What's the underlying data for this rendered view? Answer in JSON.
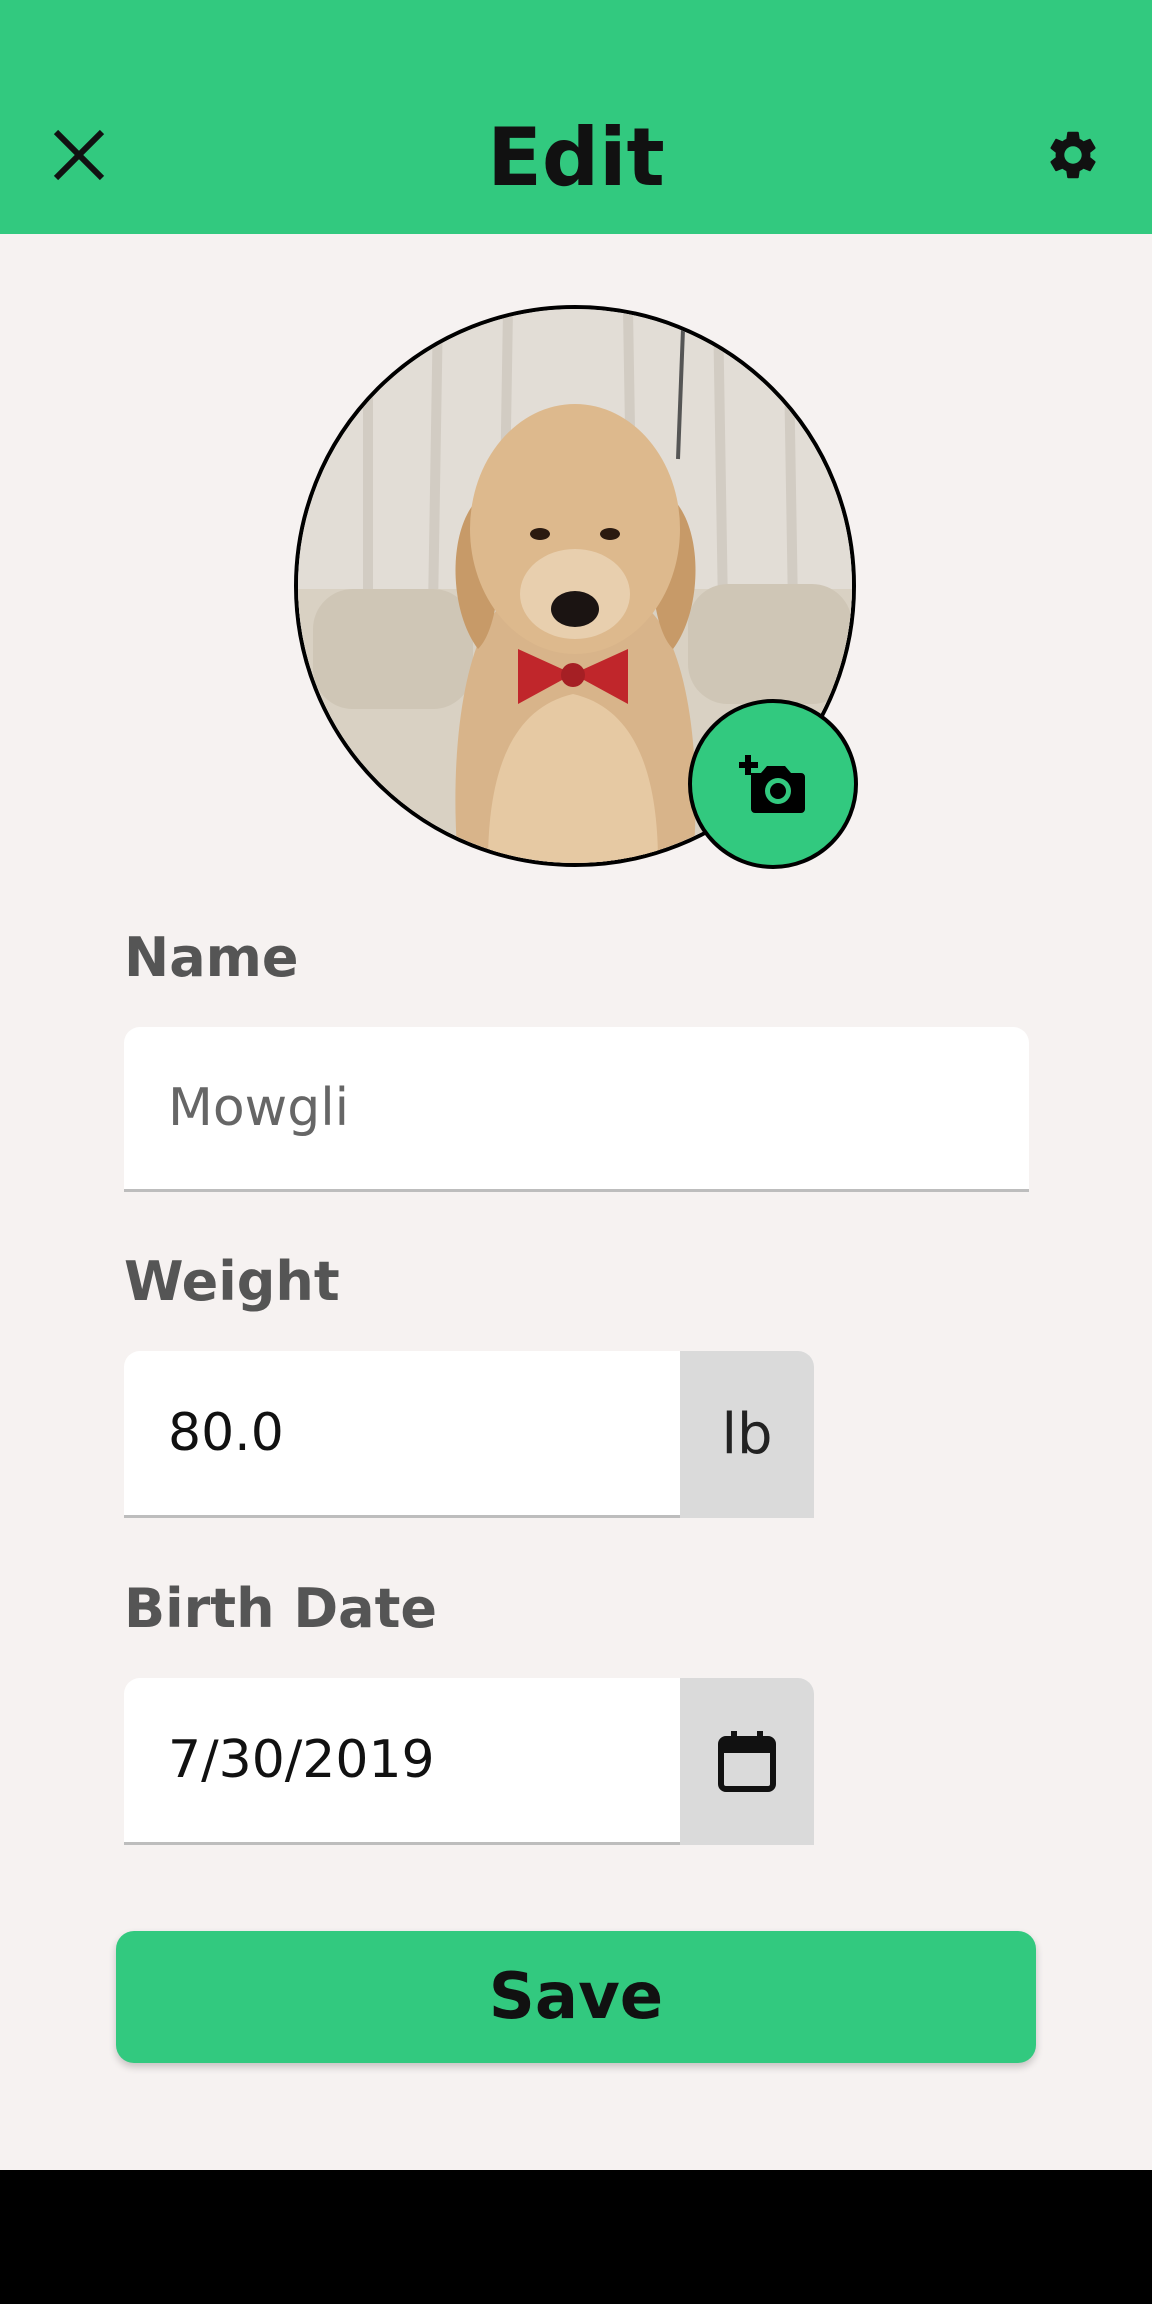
{
  "header": {
    "title": "Edit",
    "close_icon": "close-icon",
    "settings_icon": "gear-icon"
  },
  "profile": {
    "photo_alt": "Golden retriever wearing a red bow tie",
    "camera_icon": "add-photo-icon"
  },
  "form": {
    "name_label": "Name",
    "name_value": "Mowgli",
    "weight_label": "Weight",
    "weight_value": "80.0",
    "weight_unit": "lb",
    "birth_label": "Birth Date",
    "birth_value": "7/30/2019",
    "calendar_icon": "calendar-icon"
  },
  "actions": {
    "save_label": "Save"
  },
  "colors": {
    "accent": "#32c97f",
    "background": "#f6f2f1"
  }
}
